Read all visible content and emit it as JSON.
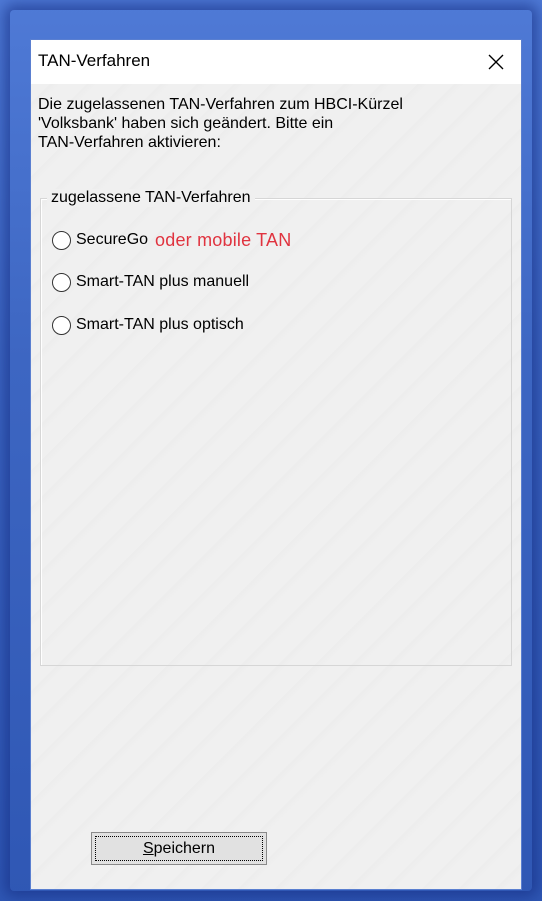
{
  "window": {
    "title": "TAN-Verfahren",
    "message": "Die zugelassenen TAN-Verfahren zum HBCI-Kürzel\n'Volksbank' haben sich geändert. Bitte ein\nTAN-Verfahren aktivieren:"
  },
  "group": {
    "legend": "zugelassene TAN-Verfahren",
    "options": [
      {
        "label": "SecureGo",
        "annotation": "oder mobile TAN",
        "selected": false
      },
      {
        "label": "Smart-TAN plus manuell",
        "selected": false
      },
      {
        "label": "Smart-TAN plus optisch",
        "selected": false
      }
    ]
  },
  "buttons": {
    "save_mnemonic": "S",
    "save_rest": "peichern"
  },
  "colors": {
    "annotation": "#e0333f",
    "desktop": "#3f69c4"
  },
  "icons": {
    "close": "close-icon"
  }
}
